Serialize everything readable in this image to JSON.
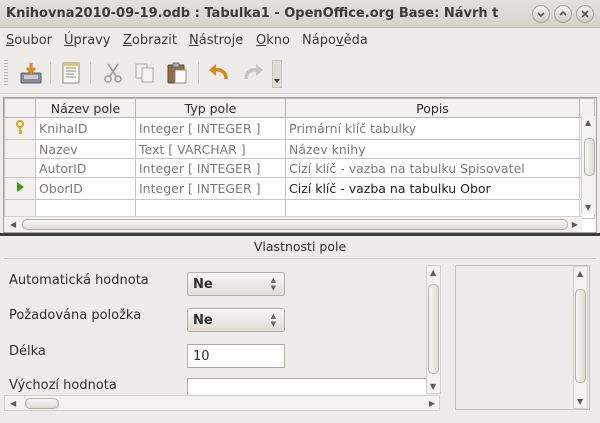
{
  "window": {
    "title": "Knihovna2010-09-19.odb : Tabulka1 - OpenOffice.org Base: Návrh t"
  },
  "menubar": {
    "items": [
      {
        "pre": "",
        "u": "S",
        "post": "oubor"
      },
      {
        "pre": "",
        "u": "Ú",
        "post": "pravy"
      },
      {
        "pre": "",
        "u": "Z",
        "post": "obrazit"
      },
      {
        "pre": "",
        "u": "N",
        "post": "ástroje"
      },
      {
        "pre": "",
        "u": "O",
        "post": "kno"
      },
      {
        "pre": "Nápo",
        "u": "v",
        "post": "ěda"
      }
    ]
  },
  "toolbar": {
    "icons": [
      "save-icon",
      "edit-document-icon",
      "cut-icon",
      "copy-icon",
      "paste-icon",
      "undo-icon",
      "redo-icon"
    ]
  },
  "grid": {
    "columns": [
      "Název pole",
      "Typ pole",
      "Popis"
    ],
    "rows": [
      {
        "marker": "key",
        "name": "KnihaID",
        "type": "Integer [ INTEGER ]",
        "desc": "Primární klíč tabulky"
      },
      {
        "marker": "",
        "name": "Nazev",
        "type": "Text [ VARCHAR ]",
        "desc": "Název knihy"
      },
      {
        "marker": "",
        "name": "AutorID",
        "type": "Integer [ INTEGER ]",
        "desc": "Cizí klíč - vazba na tabulku Spisovatel"
      },
      {
        "marker": "current",
        "name": "OborID",
        "type": "Integer [ INTEGER ]",
        "desc": "Cizí klíč - vazba na tabulku Obor"
      }
    ]
  },
  "properties": {
    "title": "Vlastnosti pole",
    "auto_label": "Automatická hodnota",
    "auto_value": "Ne",
    "required_label": "Požadována položka",
    "required_value": "Ne",
    "length_label": "Délka",
    "length_value": "10",
    "default_label": "Výchozí hodnota",
    "default_value": ""
  },
  "colors": {
    "key_icon": "#d9a21a",
    "current_arrow": "#3a9a1a"
  }
}
